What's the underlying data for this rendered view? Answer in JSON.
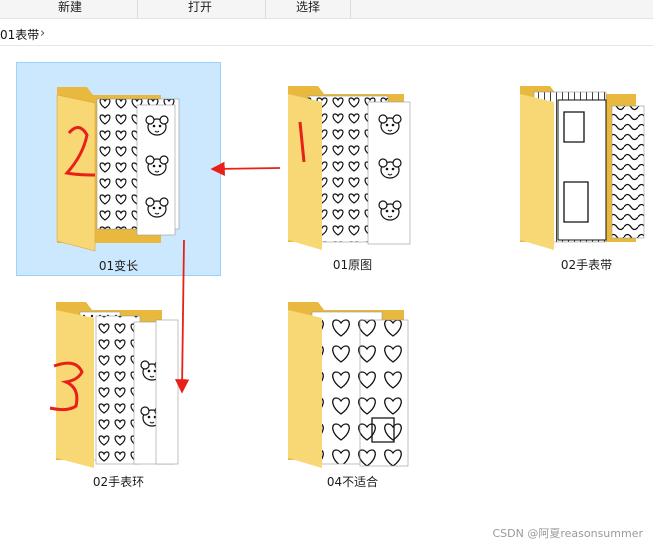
{
  "ribbon": {
    "new_label": "新建",
    "open_label": "打开",
    "select_label": "选择"
  },
  "breadcrumb": {
    "folder": "01表带"
  },
  "folders": [
    {
      "name": "01变长",
      "selected": true,
      "annotation": "2"
    },
    {
      "name": "01原图",
      "selected": false,
      "annotation": "1"
    },
    {
      "name": "02手表带",
      "selected": false
    },
    {
      "name": "02手表环",
      "selected": false,
      "annotation": "3"
    },
    {
      "name": "04不适合",
      "selected": false
    }
  ],
  "watermark": "CSDN @阿夏reasonsummer",
  "colors": {
    "selection": "#cce8ff",
    "selection_border": "#99d1ff",
    "folder_back": "#f2c94c",
    "folder_front": "#f8d775",
    "annotation": "#e8201a"
  }
}
